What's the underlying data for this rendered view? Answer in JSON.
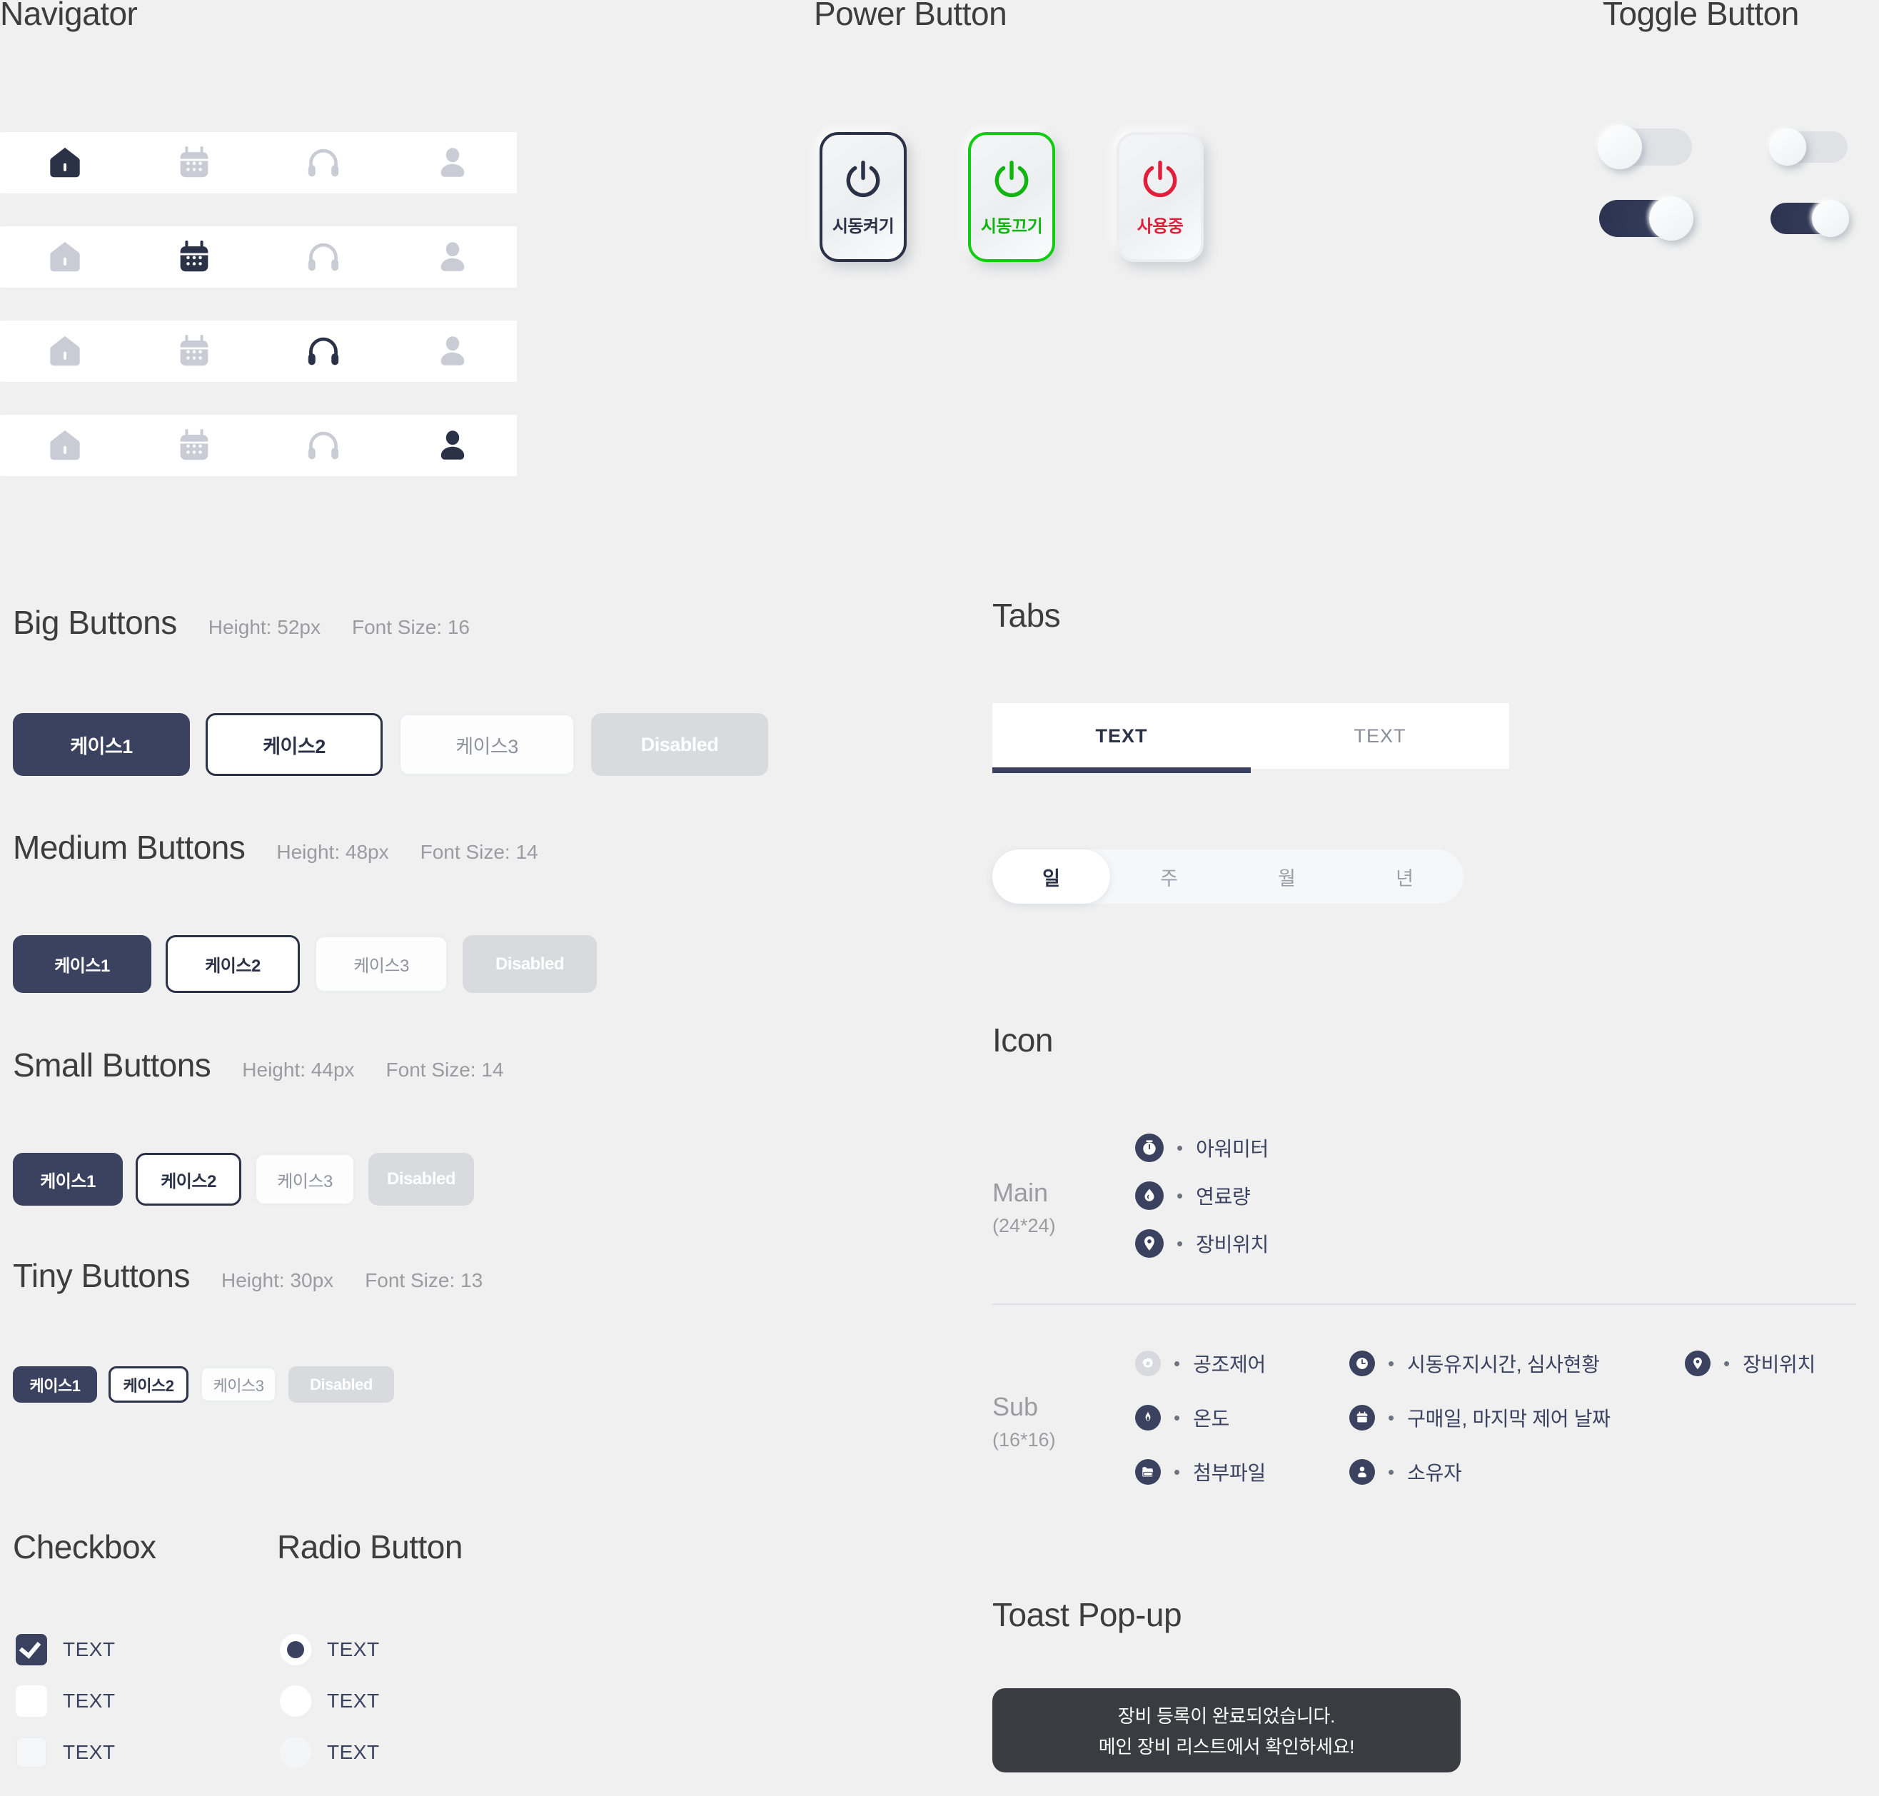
{
  "sections": {
    "navigator": "Navigator",
    "power": "Power Button",
    "toggle": "Toggle Button",
    "big_buttons": "Big Buttons",
    "medium_buttons": "Medium Buttons",
    "small_buttons": "Small Buttons",
    "tiny_buttons": "Tiny Buttons",
    "checkbox": "Checkbox",
    "radio": "Radio Button",
    "tabs": "Tabs",
    "icon": "Icon",
    "toast": "Toast Pop-up"
  },
  "navigator": {
    "items": [
      "home-icon",
      "calendar-icon",
      "headset-icon",
      "person-icon"
    ],
    "rows": [
      {
        "active_index": 0
      },
      {
        "active_index": 1
      },
      {
        "active_index": 2
      },
      {
        "active_index": 3
      }
    ]
  },
  "power_buttons": [
    {
      "label": "시동켜기",
      "state": "ready",
      "color": "#2b3146"
    },
    {
      "label": "시동끄기",
      "state": "on",
      "color": "#11b511"
    },
    {
      "label": "사용중",
      "state": "in-use",
      "color": "#e01f3d"
    }
  ],
  "toggles": [
    {
      "size": "large",
      "state": "off"
    },
    {
      "size": "small",
      "state": "off"
    },
    {
      "size": "large",
      "state": "on"
    },
    {
      "size": "small",
      "state": "on"
    }
  ],
  "button_groups": [
    {
      "title": "Big Buttons",
      "height": "Height: 52px",
      "font_size": "Font Size: 16",
      "labels": [
        "케이스1",
        "케이스2",
        "케이스3",
        "Disabled"
      ]
    },
    {
      "title": "Medium Buttons",
      "height": "Height: 48px",
      "font_size": "Font Size: 14",
      "labels": [
        "케이스1",
        "케이스2",
        "케이스3",
        "Disabled"
      ]
    },
    {
      "title": "Small Buttons",
      "height": "Height: 44px",
      "font_size": "Font Size: 14",
      "labels": [
        "케이스1",
        "케이스2",
        "케이스3",
        "Disabled"
      ]
    },
    {
      "title": "Tiny Buttons",
      "height": "Height: 30px",
      "font_size": "Font Size: 13",
      "labels": [
        "케이스1",
        "케이스2",
        "케이스3",
        "Disabled"
      ]
    }
  ],
  "checkboxes": [
    {
      "label": "TEXT",
      "state": "checked"
    },
    {
      "label": "TEXT",
      "state": "unchecked"
    },
    {
      "label": "TEXT",
      "state": "disabled"
    }
  ],
  "radios": [
    {
      "label": "TEXT",
      "state": "selected"
    },
    {
      "label": "TEXT",
      "state": "unselected"
    },
    {
      "label": "TEXT",
      "state": "disabled"
    }
  ],
  "tabs": {
    "underline_tabs": [
      {
        "label": "TEXT",
        "active": true
      },
      {
        "label": "TEXT",
        "active": false
      }
    ],
    "pill_tabs": [
      {
        "label": "일",
        "active": true
      },
      {
        "label": "주",
        "active": false
      },
      {
        "label": "월",
        "active": false
      },
      {
        "label": "년",
        "active": false
      }
    ]
  },
  "icons": {
    "main": {
      "group_label": "Main",
      "group_size": "(24*24)",
      "items": [
        {
          "icon": "gauge-icon",
          "label": "아워미터",
          "muted": false
        },
        {
          "icon": "fuel-drop-icon",
          "label": "연료량",
          "muted": false
        },
        {
          "icon": "location-pin-icon",
          "label": "장비위치",
          "muted": false
        }
      ]
    },
    "sub": {
      "group_label": "Sub",
      "group_size": "(16*16)",
      "columns": [
        [
          {
            "icon": "gear-icon",
            "label": "공조제어",
            "muted": true
          },
          {
            "icon": "flame-icon",
            "label": "온도",
            "muted": false
          },
          {
            "icon": "folder-icon",
            "label": "첨부파일",
            "muted": false
          }
        ],
        [
          {
            "icon": "clock-icon",
            "label": "시동유지시간, 심사현황",
            "muted": false
          },
          {
            "icon": "calendar-icon",
            "label": "구매일, 마지막 제어 날짜",
            "muted": false
          },
          {
            "icon": "person-icon",
            "label": "소유자",
            "muted": false
          }
        ],
        [
          {
            "icon": "location-pin-icon",
            "label": "장비위치",
            "muted": false
          }
        ]
      ]
    }
  },
  "toast": {
    "line1": "장비 등록이 완료되었습니다.",
    "line2": "메인 장비 리스트에서 확인하세요!"
  },
  "colors": {
    "background": "#f0f0f0",
    "primary": "#3b4260",
    "primary_dark": "#2b3146",
    "muted": "#9b9ba1",
    "green": "#11b511",
    "red": "#e01f3d",
    "toast_bg": "#3b3c42"
  }
}
